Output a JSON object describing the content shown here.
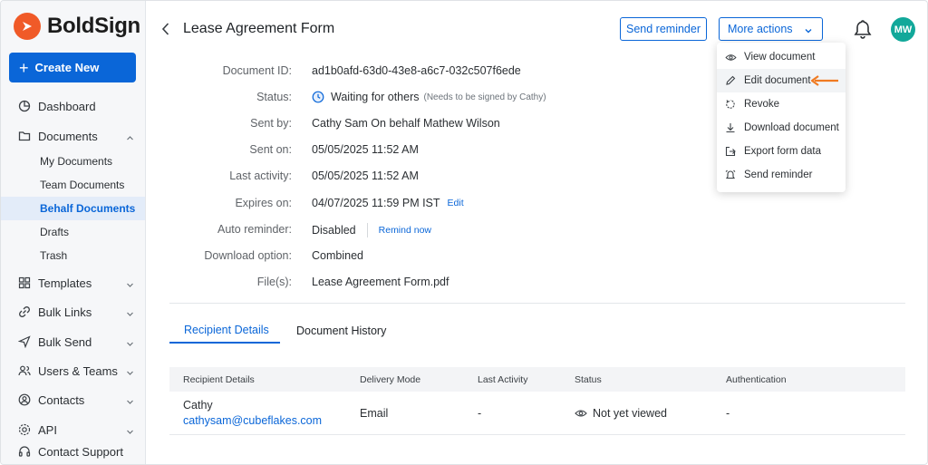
{
  "brand": {
    "name": "BoldSign",
    "color": "#f05a28"
  },
  "sidebar": {
    "create_label": "Create New",
    "items": [
      {
        "label": "Dashboard",
        "icon": "dashboard-icon"
      },
      {
        "label": "Documents",
        "icon": "folder-icon"
      },
      {
        "label": "Templates",
        "icon": "grid-icon"
      },
      {
        "label": "Bulk Links",
        "icon": "link-icon"
      },
      {
        "label": "Bulk Send",
        "icon": "send-icon"
      },
      {
        "label": "Users & Teams",
        "icon": "users-icon"
      },
      {
        "label": "Contacts",
        "icon": "contact-icon"
      },
      {
        "label": "API",
        "icon": "api-icon"
      },
      {
        "label": "Contact Support",
        "icon": "headset-icon"
      }
    ],
    "documents_sub": [
      "My Documents",
      "Team Documents",
      "Behalf Documents",
      "Drafts",
      "Trash"
    ],
    "active_sub": "Behalf Documents"
  },
  "header": {
    "title": "Lease Agreement Form",
    "send_reminder": "Send reminder",
    "more_actions": "More actions",
    "avatar_initials": "MW"
  },
  "details": [
    {
      "label": "Document ID:",
      "value": "ad1b0afd-63d0-43e8-a6c7-032c507f6ede"
    },
    {
      "label": "Status:",
      "value": "Waiting for others",
      "note": "(Needs to be signed by Cathy)"
    },
    {
      "label": "Sent by:",
      "value": "Cathy Sam On behalf Mathew Wilson"
    },
    {
      "label": "Sent on:",
      "value": "05/05/2025 11:52 AM"
    },
    {
      "label": "Last activity:",
      "value": "05/05/2025 11:52 AM"
    },
    {
      "label": "Expires on:",
      "value": "04/07/2025 11:59 PM IST",
      "link": "Edit"
    },
    {
      "label": "Auto reminder:",
      "value": "Disabled",
      "link": "Remind now"
    },
    {
      "label": "Download option:",
      "value": "Combined"
    },
    {
      "label": "File(s):",
      "value": "Lease Agreement Form.pdf"
    }
  ],
  "tabs": [
    "Recipient Details",
    "Document History"
  ],
  "table": {
    "headers": [
      "Recipient Details",
      "Delivery Mode",
      "Last Activity",
      "Status",
      "Authentication"
    ],
    "rows": [
      {
        "name": "Cathy",
        "email": "cathysam@cubeflakes.com",
        "delivery": "Email",
        "last_activity": "-",
        "status": "Not yet viewed",
        "auth": "-"
      }
    ]
  },
  "menu": {
    "items": [
      {
        "label": "View document",
        "icon": "eye-icon"
      },
      {
        "label": "Edit document",
        "icon": "pencil-icon"
      },
      {
        "label": "Revoke",
        "icon": "revoke-icon"
      },
      {
        "label": "Download document",
        "icon": "download-icon"
      },
      {
        "label": "Export form data",
        "icon": "export-icon"
      },
      {
        "label": "Send reminder",
        "icon": "alarm-icon"
      }
    ],
    "highlighted": "Edit document"
  },
  "colors": {
    "accent": "#0a66d8",
    "callout_arrow": "#f07b22",
    "avatar": "#12a89a"
  }
}
